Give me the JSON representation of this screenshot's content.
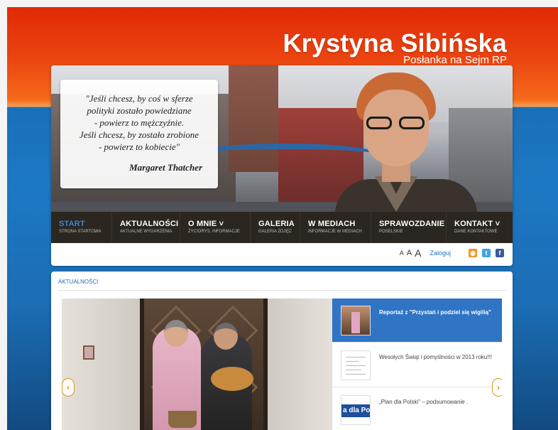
{
  "header": {
    "site_title": "Krystyna Sibińska",
    "site_subtitle": "Posłanka na Sejm RP"
  },
  "banner": {
    "quote": "\"Jeśli chcesz, by coś w sferze\npolityki zostało powiedziane\n- powierz to mężczyźnie.\nJeśli chcesz, by zostało zrobione\n- powierz to kobiecie\"",
    "author": "Margaret Thatcher"
  },
  "nav": {
    "items": [
      {
        "label": "START",
        "sub": "STRONA STARTOWA"
      },
      {
        "label": "AKTUALNOŚCI",
        "sub": "AKTUALNE WYDARZENIA"
      },
      {
        "label": "O MNIE ˅",
        "sub": "ŻYCIORYS, INFORMACJE"
      },
      {
        "label": "GALERIA",
        "sub": "GALERIA ZDJĘĆ"
      },
      {
        "label": "W MEDIACH",
        "sub": "INFORMACJE W MEDIACH"
      },
      {
        "label": "SPRAWOZDANIE",
        "sub": "POSELSKIE"
      },
      {
        "label": "KONTAKT ˅",
        "sub": "DANE KONTAKTOWE"
      }
    ]
  },
  "tools": {
    "font_small": "A",
    "font_medium": "A",
    "font_large": "A",
    "login": "Zaloguj",
    "icons": [
      "rss-icon",
      "twitter-icon",
      "facebook-icon"
    ]
  },
  "content": {
    "section_title": "AKTUALNOŚCI",
    "news": [
      {
        "title": "Reportaż z \"Przystań i podziel się wigilią\""
      },
      {
        "title": "Wesołych Świąt i pomyślności w 2013 roku!!!"
      },
      {
        "title": "„Plan dla Polski\" – podsumowanie ."
      }
    ],
    "thumb3_text": "a dla Po",
    "arrow_prev": "‹",
    "arrow_next": "›"
  }
}
